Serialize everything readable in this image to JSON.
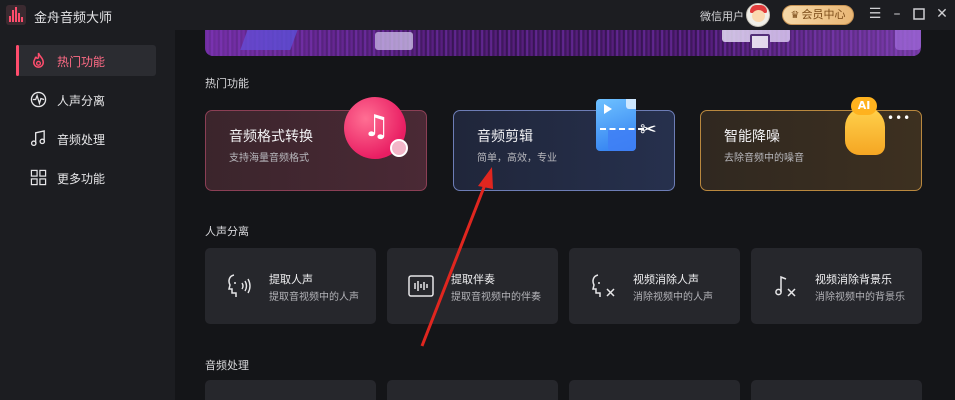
{
  "app": {
    "title": "金舟音频大师",
    "user_name": "微信用户",
    "member_label": "会员中心",
    "icons": {
      "logo": "waveform-logo-icon",
      "crown": "crown-icon",
      "menu": "menu-icon",
      "minimize": "minimize-icon",
      "maximize": "maximize-icon",
      "close": "close-icon"
    }
  },
  "sidebar": {
    "items": [
      {
        "label": "热门功能",
        "icon": "flame-icon",
        "active": true
      },
      {
        "label": "人声分离",
        "icon": "voice-wave-icon",
        "active": false
      },
      {
        "label": "音频处理",
        "icon": "music-note-icon",
        "active": false
      },
      {
        "label": "更多功能",
        "icon": "grid-icon",
        "active": false
      }
    ]
  },
  "main": {
    "hot_section": {
      "title": "热门功能",
      "cards": [
        {
          "title": "音频格式转换",
          "desc": "支持海量音频格式",
          "icon": "audio-convert-icon"
        },
        {
          "title": "音频剪辑",
          "desc": "简单，高效，专业",
          "icon": "audio-cut-icon"
        },
        {
          "title": "智能降噪",
          "desc": "去除音频中的噪音",
          "icon": "ai-denoise-icon"
        }
      ]
    },
    "vocal_section": {
      "title": "人声分离",
      "cards": [
        {
          "title": "提取人声",
          "desc": "提取音视频中的人声",
          "icon": "voice-extract-icon"
        },
        {
          "title": "提取伴奏",
          "desc": "提取音视频中的伴奏",
          "icon": "accompaniment-icon"
        },
        {
          "title": "视频消除人声",
          "desc": "消除视频中的人声",
          "icon": "remove-voice-icon"
        },
        {
          "title": "视频消除背景乐",
          "desc": "消除视频中的背景乐",
          "icon": "remove-music-icon"
        }
      ]
    },
    "process_section": {
      "title": "音频处理"
    }
  },
  "colors": {
    "accent": "#ff4d6d",
    "background": "#141518",
    "sidebar": "#1c1d21",
    "card": "#26272c",
    "annotation_arrow": "#e0261f"
  }
}
